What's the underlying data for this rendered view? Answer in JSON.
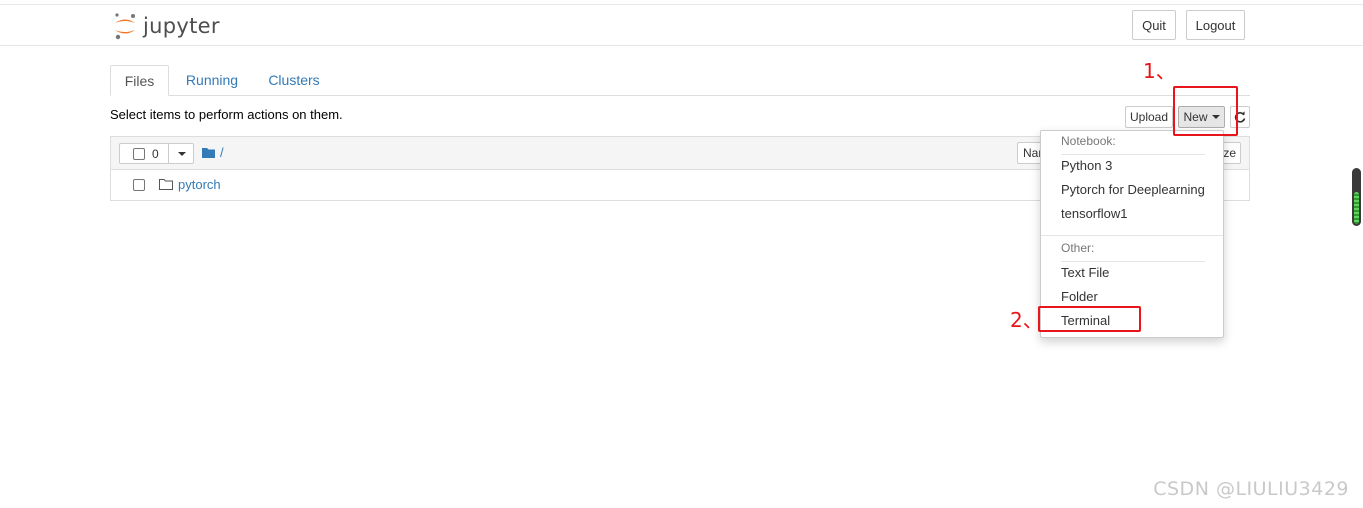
{
  "header": {
    "logo_text": "jupyter",
    "quit_label": "Quit",
    "logout_label": "Logout"
  },
  "tabs": [
    {
      "label": "Files"
    },
    {
      "label": "Running"
    },
    {
      "label": "Clusters"
    }
  ],
  "toolbar": {
    "hint": "Select items to perform actions on them.",
    "upload_label": "Upload",
    "new_label": "New",
    "refresh_icon": "refresh-icon"
  },
  "list": {
    "selected_count": "0",
    "breadcrumb_path": "/",
    "name_header_partial": "Nar",
    "size_header_partial": "ze",
    "rows": [
      {
        "name": "pytorch",
        "type_icon": "folder-icon"
      }
    ]
  },
  "new_menu": {
    "notebook_header": "Notebook:",
    "notebooks": [
      "Python 3",
      "Pytorch for Deeplearning",
      "tensorflow1"
    ],
    "other_header": "Other:",
    "others": [
      "Text File",
      "Folder",
      "Terminal"
    ]
  },
  "annotations": {
    "step1": "1、",
    "step2": "2、",
    "color": "#e8161a"
  },
  "watermark": "CSDN @LIULIU3429",
  "colors": {
    "link": "#337ab7",
    "logo_orange": "#f37726"
  }
}
